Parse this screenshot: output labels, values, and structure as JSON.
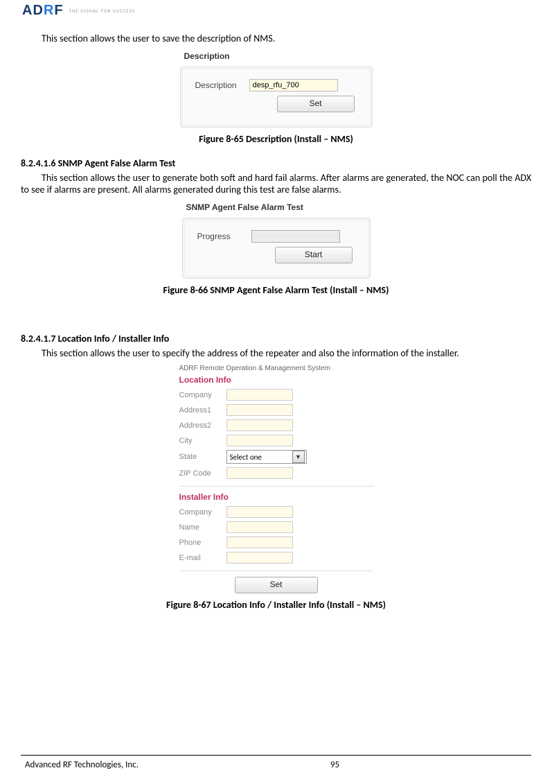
{
  "header": {
    "logo_text": "ADRF",
    "tagline": "THE SIGNAL FOR SUCCESS"
  },
  "sec1": {
    "intro": "This section allows the user to save the description of NMS.",
    "panel_title": "Description",
    "label": "Description",
    "input_value": "desp_rfu_700",
    "button": "Set",
    "caption": "Figure 8-65   Description (Install – NMS)"
  },
  "sec2": {
    "heading": "8.2.4.1.6   SNMP Agent False Alarm Test",
    "intro": "This section allows the user to generate both soft and hard fail alarms.  After alarms are generated, the NOC can poll the ADX to see if alarms are present.  All alarms generated during this test are false alarms.",
    "panel_title": "SNMP Agent False Alarm Test",
    "label": "Progress",
    "button": "Start",
    "caption": "Figure 8-66   SNMP Agent False Alarm Test (Install – NMS)"
  },
  "sec3": {
    "heading": "8.2.4.1.7   Location Info / Installer Info",
    "intro": "This section allows the user to specify the address of the repeater and also the information of the installer.",
    "sys_title": "ADRF Remote Operation & Management System",
    "loc_title": "Location Info",
    "loc_labels": {
      "company": "Company",
      "address1": "Address1",
      "address2": "Address2",
      "city": "City",
      "state": "State",
      "zip": "ZIP Code"
    },
    "state_value": "Select one",
    "inst_title": "Installer Info",
    "inst_labels": {
      "company": "Company",
      "name": "Name",
      "phone": "Phone",
      "email": "E-mail"
    },
    "button": "Set",
    "caption": "Figure 8-67   Location Info / Installer Info (Install – NMS)"
  },
  "footer": {
    "left": "Advanced RF Technologies, Inc.",
    "page": "95"
  }
}
